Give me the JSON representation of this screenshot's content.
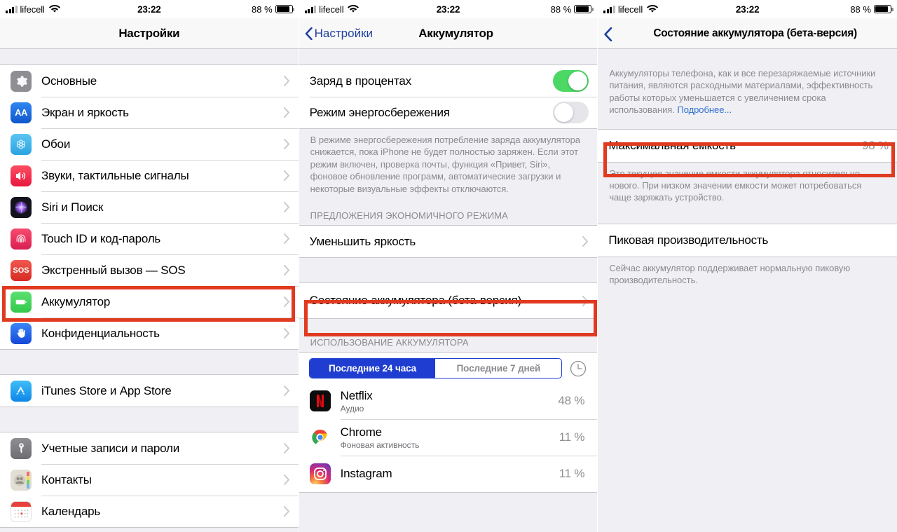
{
  "status_bar": {
    "carrier": "lifecell",
    "time": "23:22",
    "battery_percent": "88 %",
    "signal_icon": "cellular-bars-icon",
    "wifi_icon": "wifi-icon",
    "battery_icon": "battery-icon"
  },
  "panel_settings": {
    "title": "Настройки",
    "groups": [
      {
        "items": [
          {
            "label": "Основные",
            "icon": "gear-icon",
            "icon_color": "#8e8e93"
          },
          {
            "label": "Экран и яркость",
            "icon": "display-brightness-icon",
            "icon_color": "#1277e8"
          },
          {
            "label": "Обои",
            "icon": "wallpaper-flower-icon",
            "icon_color": "#45b6ef"
          },
          {
            "label": "Звуки, тактильные сигналы",
            "icon": "speaker-icon",
            "icon_color": "#f0354f"
          },
          {
            "label": "Siri и Поиск",
            "icon": "siri-icon",
            "icon_color": "#1c1c2b"
          },
          {
            "label": "Touch ID и код-пароль",
            "icon": "fingerprint-icon",
            "icon_color": "#e83456"
          },
          {
            "label": "Экстренный вызов — SOS",
            "icon": "sos-icon",
            "icon_color": "#e33b33"
          },
          {
            "label": "Аккумулятор",
            "icon": "battery-green-icon",
            "icon_color": "#4cd864",
            "highlighted": true
          },
          {
            "label": "Конфиденциальность",
            "icon": "hand-privacy-icon",
            "icon_color": "#1f63e8"
          }
        ]
      },
      {
        "items": [
          {
            "label": "iTunes Store и App Store",
            "icon": "app-store-icon",
            "icon_color": "#2a9df4"
          }
        ]
      },
      {
        "items": [
          {
            "label": "Учетные записи и пароли",
            "icon": "key-icon",
            "icon_color": "#7c7c80"
          },
          {
            "label": "Контакты",
            "icon": "contacts-icon",
            "icon_color": "#d8d4cb"
          },
          {
            "label": "Календарь",
            "icon": "calendar-icon",
            "icon_color": "#ffffff"
          }
        ]
      }
    ]
  },
  "panel_battery": {
    "back_label": "Настройки",
    "title": "Аккумулятор",
    "toggles": [
      {
        "label": "Заряд в процентах",
        "on": true
      },
      {
        "label": "Режим энергосбережения",
        "on": false
      }
    ],
    "footer": "В режиме энергосбережения потребление заряда аккумулятора снижается, пока iPhone не будет полностью заряжен. Если этот режим включен, проверка почты, функция «Привет, Siri», фоновое обновление программ, автоматические загрузки и некоторые визуальные эффекты отключаются.",
    "suggestions_header": "ПРЕДЛОЖЕНИЯ ЭКОНОМИЧНОГО РЕЖИМА",
    "suggestion_row": "Уменьшить яркость",
    "health_row": "Состояние аккумулятора (бета-версия)",
    "usage_header": "ИСПОЛЬЗОВАНИЕ АККУМУЛЯТОРА",
    "segments": [
      {
        "label": "Последние 24 часа",
        "active": true
      },
      {
        "label": "Последние 7 дней",
        "active": false
      }
    ],
    "clock_icon": "clock-icon",
    "apps": [
      {
        "name": "Netflix",
        "subtitle": "Аудио",
        "percent": "48 %",
        "icon": "netflix-icon"
      },
      {
        "name": "Chrome",
        "subtitle": "Фоновая активность",
        "percent": "11 %",
        "icon": "chrome-icon"
      },
      {
        "name": "Instagram",
        "subtitle": "",
        "percent": "11 %",
        "icon": "instagram-icon"
      }
    ]
  },
  "panel_health": {
    "title": "Состояние аккумулятора (бета-версия)",
    "intro": "Аккумуляторы телефона, как и все перезаряжаемые источники питания, являются расходными материалами, эффективность работы которых уменьшается с увеличением срока использования. ",
    "intro_link": "Подробнее...",
    "capacity_label": "Максимальная емкость",
    "capacity_value": "98 %",
    "capacity_footer": "Это текущее значение емкости аккумулятора относительно нового. При низком значении емкости может потребоваться чаще заряжать устройство.",
    "peak_label": "Пиковая производительность",
    "peak_footer": "Сейчас аккумулятор поддерживает нормальную пиковую производительность."
  },
  "theme": {
    "highlight_color": "#e03a20",
    "accent_blue": "#1f3ed1",
    "link_blue": "#2f6fd0",
    "switch_on": "#4cd864"
  }
}
